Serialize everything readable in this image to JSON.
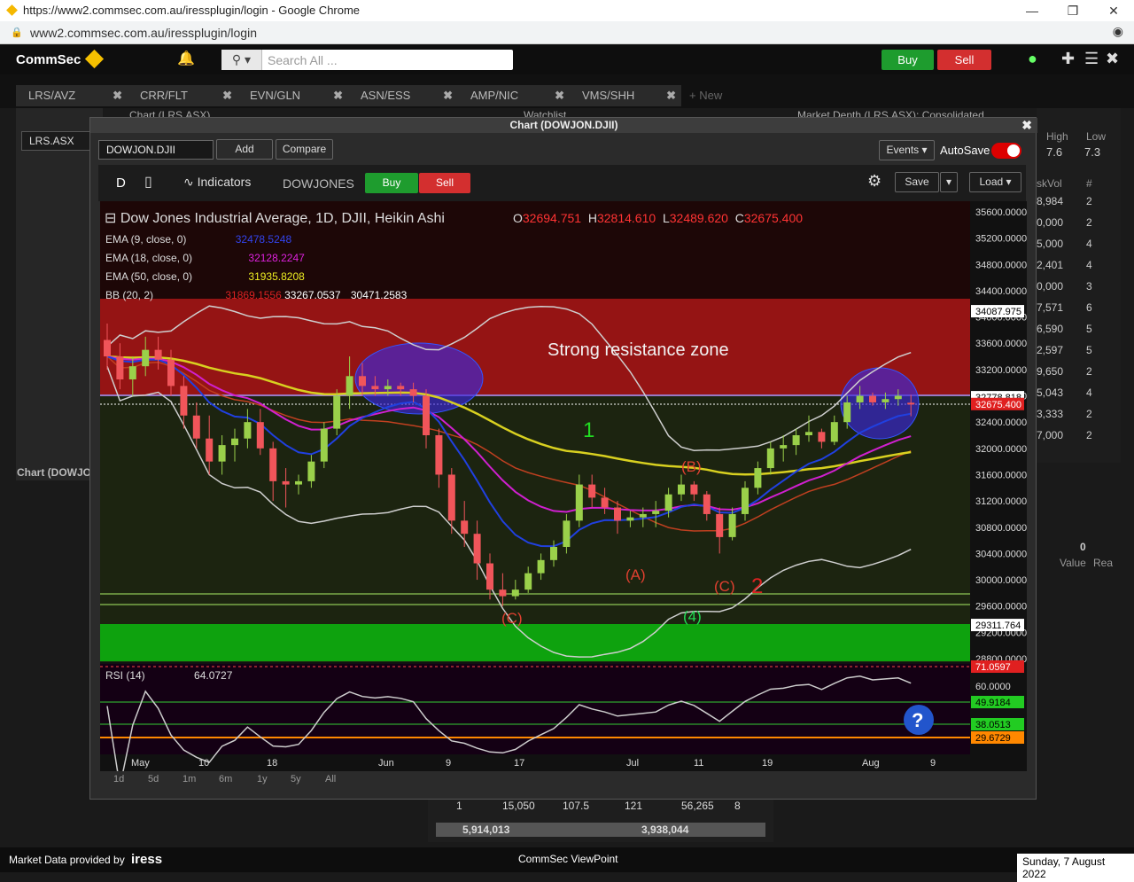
{
  "browser": {
    "title": "https://www2.commsec.com.au/iressplugin/login - Google Chrome",
    "url": "www2.commsec.com.au/iressplugin/login"
  },
  "app": {
    "logo": "CommSec",
    "search_placeholder": "Search All ...",
    "buy": "Buy",
    "sell": "Sell"
  },
  "tabs": [
    {
      "label": "LRS/AVZ"
    },
    {
      "label": "CRR/FLT"
    },
    {
      "label": "EVN/GLN"
    },
    {
      "label": "ASN/ESS"
    },
    {
      "label": "AMP/NIC"
    },
    {
      "label": "VMS/SHH"
    }
  ],
  "new_tab": "+ New",
  "panels": {
    "chart_left": "Chart (LRS.ASX)",
    "watchlist": "Watchlist",
    "market_depth": "Market Depth (LRS.ASX): Consolidated...",
    "left_code": "LRS.ASX",
    "left_chart2": "Chart (DOWJO"
  },
  "chart_window": {
    "title": "Chart (DOWJON.DJII)",
    "symbol": "DOWJON.DJII",
    "add": "Add",
    "compare": "Compare",
    "events": "Events",
    "autosave": "AutoSave",
    "toolbar": {
      "interval": "D",
      "indicators": "Indicators",
      "instrument": "DOWJONES",
      "buy": "Buy",
      "sell": "Sell",
      "save": "Save",
      "load": "Load"
    },
    "legend": {
      "name": "Dow Jones Industrial Average, 1D, DJII, Heikin Ashi",
      "o_label": "O",
      "o": "32694.751",
      "h_label": "H",
      "h": "32814.610",
      "l_label": "L",
      "l": "32489.620",
      "c_label": "C",
      "c": "32675.400",
      "ema9": "EMA (9, close, 0)",
      "ema9_val": "32478.5248",
      "ema18": "EMA (18, close, 0)",
      "ema18_val": "32128.2247",
      "ema50": "EMA (50, close, 0)",
      "ema50_val": "31935.8208",
      "bb": "BB (20, 2)",
      "bb_val1": "31869.1556",
      "bb_val2": "33267.0537",
      "bb_val3": "30471.2583"
    },
    "annotation": "Strong resistance zone",
    "wave": {
      "one": "1",
      "two": "2",
      "a": "(A)",
      "b": "(B)",
      "c1": "(C)",
      "c2": "(C)",
      "four": "(4)"
    },
    "rsi": {
      "label": "RSI (14)",
      "value": "64.0727"
    },
    "price_axis": [
      "35600.0000",
      "35200.0000",
      "34800.0000",
      "34400.0000",
      "34000.0000",
      "33600.0000",
      "33200.0000",
      "32800.0000",
      "32400.0000",
      "32000.0000",
      "31600.0000",
      "31200.0000",
      "30800.0000",
      "30400.0000",
      "30000.0000",
      "29600.0000",
      "29200.0000",
      "28800.0000"
    ],
    "price_tags": {
      "t1": "34087.975",
      "t2": "32778.818",
      "t3": "32675.400",
      "t4": "29311.764"
    },
    "rsi_axis": {
      "a": "71.0597",
      "b": "60.0000",
      "c": "49.9184",
      "d": "38.0513",
      "e": "29.6729"
    },
    "time_axis": [
      "May",
      "10",
      "18",
      "Jun",
      "9",
      "17",
      "Jul",
      "11",
      "19",
      "Aug",
      "9"
    ],
    "ranges": [
      "1d",
      "5d",
      "1m",
      "6m",
      "1y",
      "5y",
      "All"
    ]
  },
  "right_panel": {
    "high_label": "High",
    "low_label": "Low",
    "high": "7.6",
    "low": "7.3",
    "askvol": "skVol",
    "hash": "#",
    "rows": [
      [
        "8,984",
        "2"
      ],
      [
        "0,000",
        "2"
      ],
      [
        "5,000",
        "4"
      ],
      [
        "2,401",
        "4"
      ],
      [
        "0,000",
        "3"
      ],
      [
        "7,571",
        "6"
      ],
      [
        "6,590",
        "5"
      ],
      [
        "2,597",
        "5"
      ],
      [
        "9,650",
        "2"
      ],
      [
        "5,043",
        "4"
      ],
      [
        "3,333",
        "2"
      ],
      [
        "7,000",
        "2"
      ]
    ],
    "val": "0",
    "value": "Value",
    "rea": "Rea"
  },
  "bottom_row": {
    "a": "1",
    "b": "15,050",
    "c": "107.5",
    "d": "121",
    "e": "56,265",
    "f": "8",
    "g": "5,914,013",
    "h": "3,938,044"
  },
  "footer": {
    "provided": "Market Data provided by",
    "iress": "iress",
    "center": "CommSec ViewPoint",
    "date": "Sunday, 7 August 2022"
  },
  "colors": {
    "buy": "#1e9c2e",
    "sell": "#d32f2f",
    "resistance": "#b01010",
    "support": "#12a012"
  },
  "chart_data": {
    "type": "candlestick",
    "title": "Dow Jones Industrial Average, 1D, DJII, Heikin Ashi",
    "ylim": [
      28800,
      35600
    ],
    "ohlc": [
      [
        33650,
        33900,
        33200,
        33400
      ],
      [
        33400,
        33600,
        32900,
        33050
      ],
      [
        33050,
        33400,
        32800,
        33250
      ],
      [
        33250,
        33700,
        33100,
        33500
      ],
      [
        33500,
        33700,
        33200,
        33350
      ],
      [
        33350,
        33500,
        32800,
        32950
      ],
      [
        32950,
        33100,
        32300,
        32500
      ],
      [
        32500,
        32700,
        32000,
        32150
      ],
      [
        32150,
        32500,
        31600,
        31800
      ],
      [
        31800,
        32200,
        31600,
        32050
      ],
      [
        32050,
        32300,
        31800,
        32150
      ],
      [
        32150,
        32600,
        32000,
        32400
      ],
      [
        32400,
        32600,
        31900,
        32000
      ],
      [
        32000,
        32100,
        31200,
        31500
      ],
      [
        31500,
        31700,
        31100,
        31450
      ],
      [
        31450,
        31600,
        31300,
        31500
      ],
      [
        31500,
        31900,
        31400,
        31800
      ],
      [
        31800,
        32400,
        31700,
        32300
      ],
      [
        32300,
        32900,
        32200,
        32800
      ],
      [
        32800,
        33400,
        32600,
        33100
      ],
      [
        33100,
        33300,
        32800,
        32950
      ],
      [
        32950,
        33100,
        32800,
        32900
      ],
      [
        32900,
        33050,
        32800,
        32950
      ],
      [
        32950,
        33000,
        32800,
        32900
      ],
      [
        32900,
        33000,
        32700,
        32800
      ],
      [
        32800,
        32900,
        32000,
        32200
      ],
      [
        32200,
        32300,
        31400,
        31600
      ],
      [
        31600,
        31700,
        30700,
        30900
      ],
      [
        30900,
        31200,
        30500,
        30700
      ],
      [
        30700,
        30900,
        30000,
        30250
      ],
      [
        30250,
        30400,
        29700,
        29850
      ],
      [
        29850,
        30100,
        29600,
        29750
      ],
      [
        29750,
        30000,
        29700,
        29850
      ],
      [
        29850,
        30200,
        29800,
        30100
      ],
      [
        30100,
        30400,
        30000,
        30300
      ],
      [
        30300,
        30600,
        30200,
        30500
      ],
      [
        30500,
        31000,
        30400,
        30900
      ],
      [
        30900,
        31600,
        30800,
        31450
      ],
      [
        31450,
        31600,
        31100,
        31250
      ],
      [
        31250,
        31400,
        31000,
        31100
      ],
      [
        31100,
        31200,
        30700,
        30900
      ],
      [
        30900,
        31050,
        30800,
        30950
      ],
      [
        30950,
        31100,
        30800,
        31000
      ],
      [
        31000,
        31200,
        30800,
        31050
      ],
      [
        31050,
        31400,
        30950,
        31300
      ],
      [
        31300,
        31600,
        31200,
        31450
      ],
      [
        31450,
        31500,
        31200,
        31300
      ],
      [
        31300,
        31350,
        30900,
        31000
      ],
      [
        31000,
        31100,
        30400,
        30650
      ],
      [
        30650,
        31100,
        30600,
        31000
      ],
      [
        31000,
        31500,
        30900,
        31400
      ],
      [
        31400,
        31800,
        31300,
        31700
      ],
      [
        31700,
        32100,
        31600,
        32000
      ],
      [
        32000,
        32200,
        31800,
        32050
      ],
      [
        32050,
        32300,
        31900,
        32200
      ],
      [
        32200,
        32500,
        32100,
        32250
      ],
      [
        32250,
        32300,
        32000,
        32100
      ],
      [
        32100,
        32500,
        32050,
        32400
      ],
      [
        32400,
        32800,
        32300,
        32700
      ],
      [
        32700,
        32950,
        32600,
        32800
      ],
      [
        32800,
        32850,
        32650,
        32700
      ],
      [
        32700,
        32850,
        32600,
        32750
      ],
      [
        32750,
        32900,
        32650,
        32800
      ],
      [
        32694.751,
        32814.61,
        32489.62,
        32675.4
      ]
    ]
  }
}
